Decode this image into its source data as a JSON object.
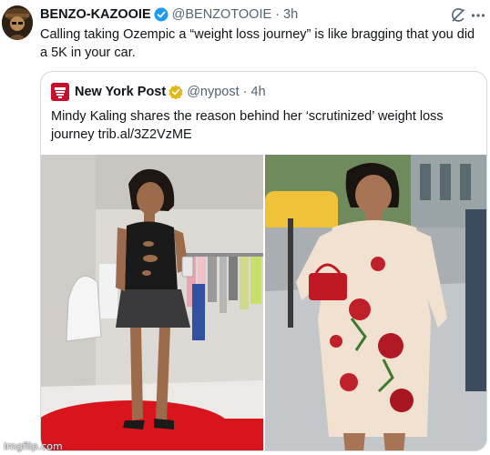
{
  "tweet": {
    "author_name": "BENZO-KAZOOIE",
    "author_handle": "@BENZOTOOIE",
    "separator": "·",
    "time": "3h",
    "text": "Calling taking Ozempic a “weight loss journey” is like bragging that you did a 5K in your car."
  },
  "quote": {
    "author_name": "New York Post",
    "author_handle": "@nypost",
    "separator": "·",
    "time": "4h",
    "text": "Mindy Kaling shares the reason behind her ‘scrutinized’ weight loss journey trib.al/3Z2VzME"
  },
  "icons": {
    "verified": "blue-check-verified-icon",
    "gold_verified": "gold-check-verified-icon",
    "grok": "grok-icon",
    "more": "more-dots-icon"
  },
  "colors": {
    "verified_blue": "#1d9bf0",
    "gold_badge": "#e2b719",
    "nypost_red": "#c8102e",
    "secondary_text": "#536471",
    "border": "#cfd9de"
  },
  "watermark": "imgflip.com"
}
